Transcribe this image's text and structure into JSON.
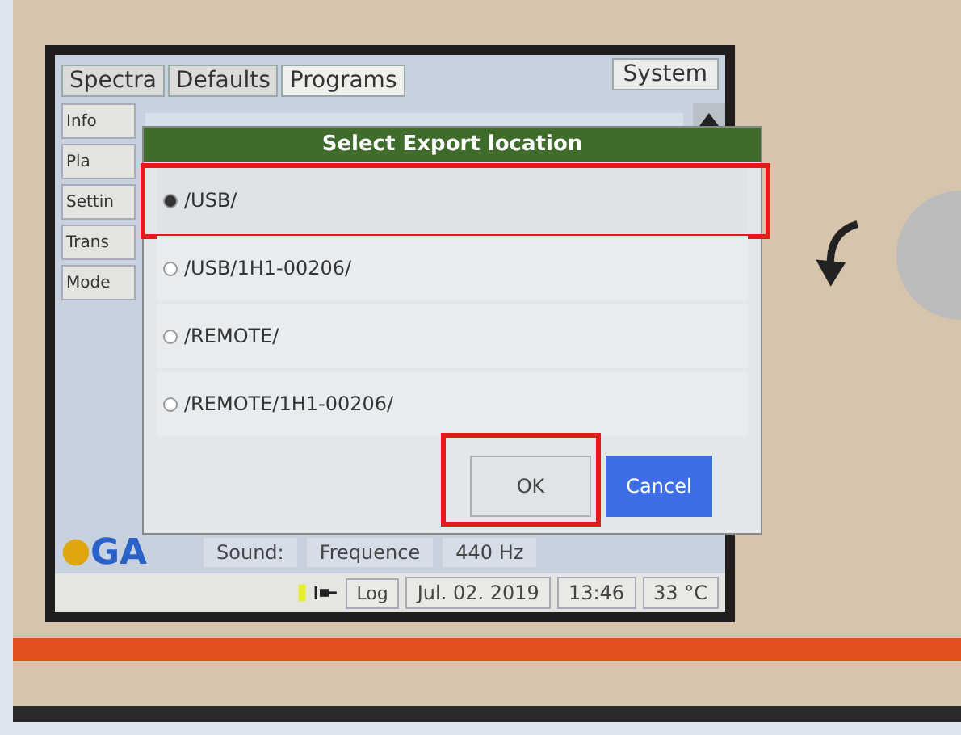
{
  "tabs": [
    {
      "label": "Spectra",
      "selected": false
    },
    {
      "label": "Defaults",
      "selected": false
    },
    {
      "label": "Programs",
      "selected": true
    }
  ],
  "system_button": {
    "label": "System"
  },
  "side_buttons": [
    "Info",
    "Pla",
    "Settin",
    "Trans",
    "Mode"
  ],
  "dialog": {
    "title": "Select Export location",
    "options": [
      {
        "label": "/USB/",
        "selected": true,
        "highlighted": true
      },
      {
        "label": "/USB/1H1-00206/",
        "selected": false,
        "highlighted": false
      },
      {
        "label": "/REMOTE/",
        "selected": false,
        "highlighted": false
      },
      {
        "label": "/REMOTE/1H1-00206/",
        "selected": false,
        "highlighted": false
      }
    ],
    "buttons": [
      {
        "label": "OK",
        "kind": "default",
        "highlighted": true
      },
      {
        "label": "Cancel",
        "kind": "primary",
        "highlighted": false
      }
    ]
  },
  "logo": {
    "text": "GA"
  },
  "fields": [
    {
      "label": "Sound:"
    },
    {
      "label": "Frequence",
      "value": "440 Hz"
    }
  ],
  "status_bar": {
    "log": "Log",
    "date": "Jul. 02. 2019",
    "time": "13:46",
    "temperature": "33 °C"
  }
}
